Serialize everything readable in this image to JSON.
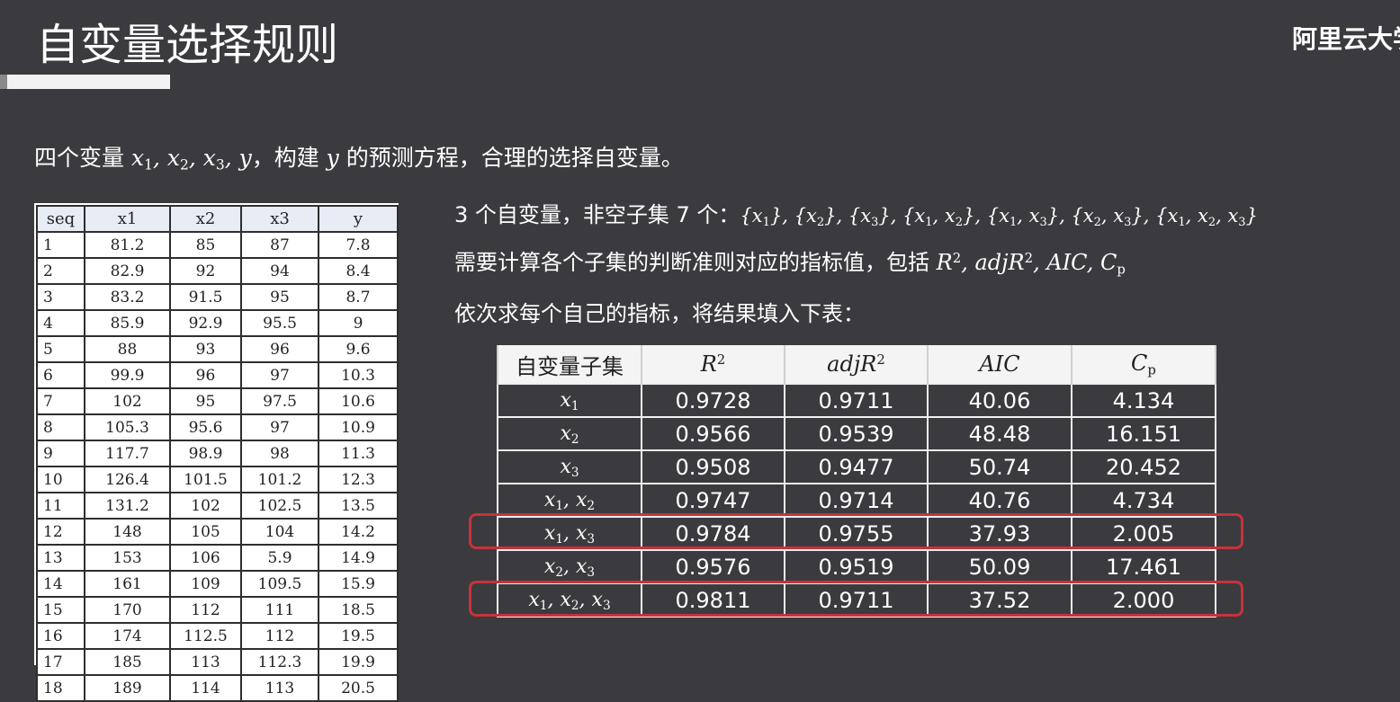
{
  "slide": {
    "title": "自变量选择规则",
    "brand": "阿里云大学"
  },
  "intro": {
    "prefix": "四个变量 ",
    "suffix_a": "，构建 ",
    "suffix_b": " 的预测方程，合理的选择自变量。"
  },
  "data_table": {
    "headers": [
      "seq",
      "x1",
      "x2",
      "x3",
      "y"
    ],
    "rows": [
      [
        "1",
        "81.2",
        "85",
        "87",
        "7.8"
      ],
      [
        "2",
        "82.9",
        "92",
        "94",
        "8.4"
      ],
      [
        "3",
        "83.2",
        "91.5",
        "95",
        "8.7"
      ],
      [
        "4",
        "85.9",
        "92.9",
        "95.5",
        "9"
      ],
      [
        "5",
        "88",
        "93",
        "96",
        "9.6"
      ],
      [
        "6",
        "99.9",
        "96",
        "97",
        "10.3"
      ],
      [
        "7",
        "102",
        "95",
        "97.5",
        "10.6"
      ],
      [
        "8",
        "105.3",
        "95.6",
        "97",
        "10.9"
      ],
      [
        "9",
        "117.7",
        "98.9",
        "98",
        "11.3"
      ],
      [
        "10",
        "126.4",
        "101.5",
        "101.2",
        "12.3"
      ],
      [
        "11",
        "131.2",
        "102",
        "102.5",
        "13.5"
      ],
      [
        "12",
        "148",
        "105",
        "104",
        "14.2"
      ],
      [
        "13",
        "153",
        "106",
        "5.9",
        "14.9"
      ],
      [
        "14",
        "161",
        "109",
        "109.5",
        "15.9"
      ],
      [
        "15",
        "170",
        "112",
        "111",
        "18.5"
      ],
      [
        "16",
        "174",
        "112.5",
        "112",
        "19.5"
      ],
      [
        "17",
        "185",
        "113",
        "112.3",
        "19.9"
      ],
      [
        "18",
        "189",
        "114",
        "113",
        "20.5"
      ]
    ]
  },
  "info": {
    "line1_prefix": "3 个自变量，非空子集 7 个：",
    "line2_prefix": "需要计算各个子集的判断准则对应的指标值，包括 ",
    "line3": "依次求每个自己的指标，将结果填入下表："
  },
  "metrics": {
    "subset_header": "自变量子集",
    "rows": [
      {
        "r2": "0.9728",
        "adjr2": "0.9711",
        "aic": "40.06",
        "cp": "4.134"
      },
      {
        "r2": "0.9566",
        "adjr2": "0.9539",
        "aic": "48.48",
        "cp": "16.151"
      },
      {
        "r2": "0.9508",
        "adjr2": "0.9477",
        "aic": "50.74",
        "cp": "20.452"
      },
      {
        "r2": "0.9747",
        "adjr2": "0.9714",
        "aic": "40.76",
        "cp": "4.734"
      },
      {
        "r2": "0.9784",
        "adjr2": "0.9755",
        "aic": "37.93",
        "cp": "2.005",
        "highlighted": true
      },
      {
        "r2": "0.9576",
        "adjr2": "0.9519",
        "aic": "50.09",
        "cp": "17.461"
      },
      {
        "r2": "0.9811",
        "adjr2": "0.9711",
        "aic": "37.52",
        "cp": "2.000",
        "highlighted": true
      }
    ]
  },
  "colors": {
    "background": "#3b3b3f",
    "highlight": "#c8323a",
    "header_fill": "#e7ecf5"
  }
}
